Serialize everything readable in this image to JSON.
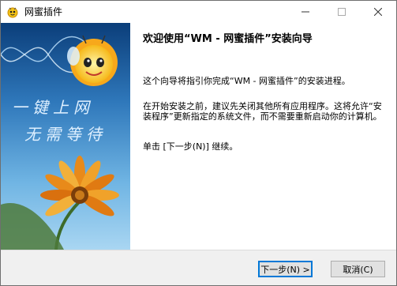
{
  "window": {
    "title": "网蜜插件"
  },
  "title_controls": {
    "minimize": "—",
    "maximize": "☐",
    "close": "✕"
  },
  "banner": {
    "slogan_line1": "一键上网",
    "slogan_line2": "无需等待"
  },
  "wizard": {
    "heading": "欢迎使用“WM - 网蜜插件”安装向导",
    "para1": "这个向导将指引你完成“WM - 网蜜插件”的安装进程。",
    "para2": "在开始安装之前，建议先关闭其他所有应用程序。这将允许“安装程序”更新指定的系统文件，而不需要重新启动你的计算机。",
    "para3": "单击 [下一步(N)] 继续。"
  },
  "buttons": {
    "next": "下一步(N) >",
    "cancel": "取消(C)"
  },
  "colors": {
    "accent": "#0078d7",
    "sky": "#4a90c8",
    "petal": "#e88a1a"
  }
}
